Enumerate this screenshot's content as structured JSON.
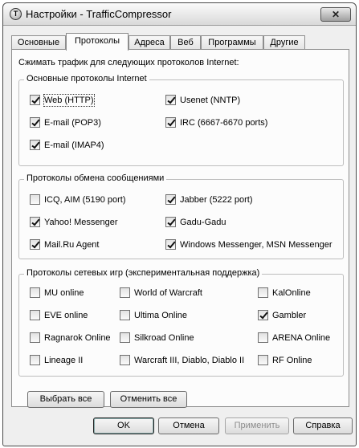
{
  "window": {
    "title": "Настройки - TrafficCompressor",
    "close_glyph": "✕",
    "icon_glyph": "T"
  },
  "tabs": [
    {
      "label": "Основные",
      "active": false
    },
    {
      "label": "Протоколы",
      "active": true
    },
    {
      "label": "Адреса",
      "active": false
    },
    {
      "label": "Веб",
      "active": false
    },
    {
      "label": "Программы",
      "active": false
    },
    {
      "label": "Другие",
      "active": false
    }
  ],
  "intro": "Сжимать трафик для следующих протоколов Internet:",
  "groups": {
    "internet": {
      "legend": "Основные протоколы Internet",
      "items": [
        {
          "label": "Web (HTTP)",
          "checked": true
        },
        {
          "label": "Usenet (NNTP)",
          "checked": true
        },
        {
          "label": "E-mail (POP3)",
          "checked": true
        },
        {
          "label": "IRC (6667-6670 ports)",
          "checked": true
        },
        {
          "label": "E-mail (IMAP4)",
          "checked": true
        }
      ]
    },
    "messaging": {
      "legend": "Протоколы обмена сообщениями",
      "items": [
        {
          "label": "ICQ, AIM (5190 port)",
          "checked": false
        },
        {
          "label": "Jabber (5222 port)",
          "checked": true
        },
        {
          "label": "Yahoo! Messenger",
          "checked": true
        },
        {
          "label": "Gadu-Gadu",
          "checked": true
        },
        {
          "label": "Mail.Ru Agent",
          "checked": true
        },
        {
          "label": "Windows Messenger, MSN Messenger",
          "checked": true
        }
      ]
    },
    "games": {
      "legend": "Протоколы сетевых игр (экспериментальная поддержка)",
      "items": [
        {
          "label": "MU online",
          "checked": false
        },
        {
          "label": "World of Warcraft",
          "checked": false
        },
        {
          "label": "KalOnline",
          "checked": false
        },
        {
          "label": "EVE online",
          "checked": false
        },
        {
          "label": "Ultima Online",
          "checked": false
        },
        {
          "label": "Gambler",
          "checked": true
        },
        {
          "label": "Ragnarok Online",
          "checked": false
        },
        {
          "label": "Silkroad Online",
          "checked": false
        },
        {
          "label": "ARENA Online",
          "checked": false
        },
        {
          "label": "Lineage II",
          "checked": false
        },
        {
          "label": "Warcraft III, Diablo, Diablo II",
          "checked": false
        },
        {
          "label": "RF Online",
          "checked": false
        }
      ]
    }
  },
  "panel_buttons": {
    "select_all": "Выбрать все",
    "deselect_all": "Отменить все"
  },
  "footer": {
    "ok": "OK",
    "cancel": "Отмена",
    "apply": "Применить",
    "apply_enabled": false,
    "help": "Справка"
  }
}
